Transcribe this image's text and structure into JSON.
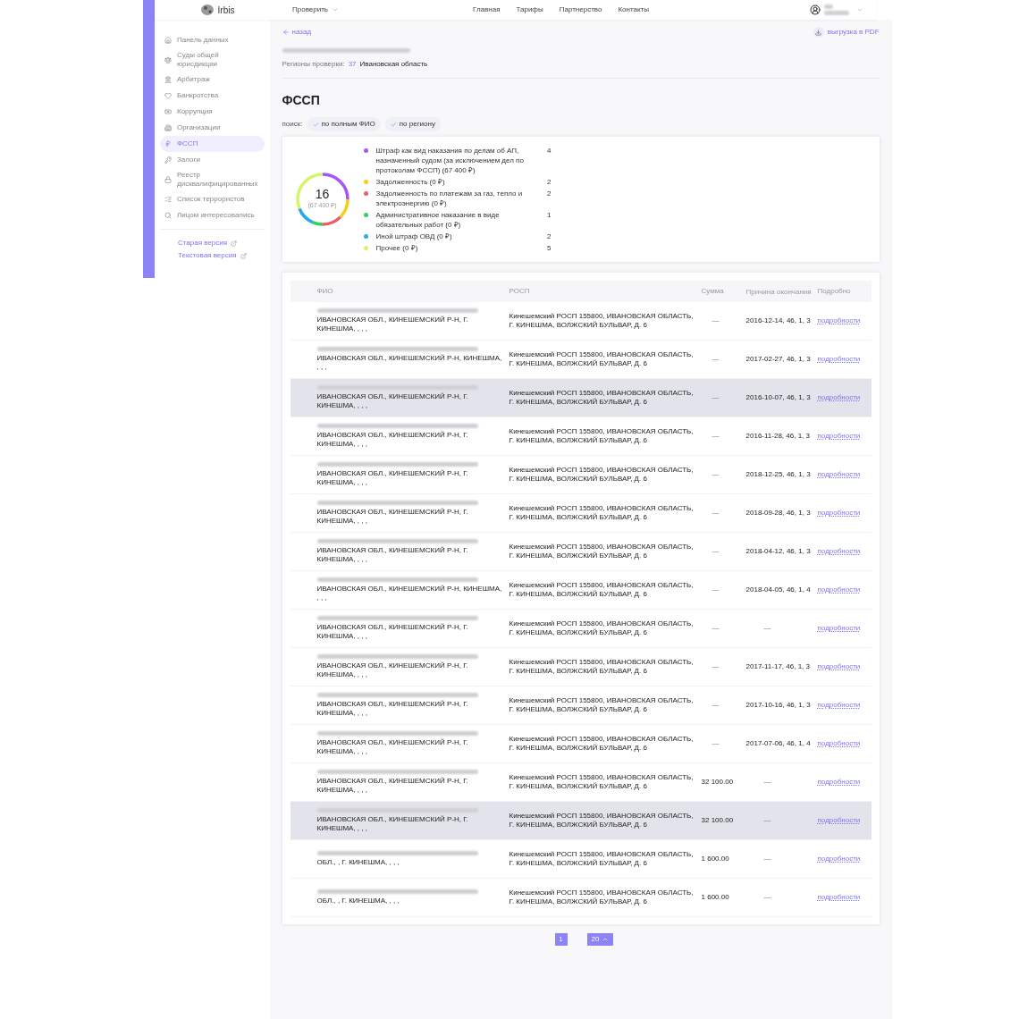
{
  "header": {
    "brand": "Irbis",
    "check_menu": "Проверить",
    "nav": [
      "Главная",
      "Тарифы",
      "Партнерство",
      "Контакты"
    ]
  },
  "sidebar": {
    "items": [
      {
        "label": "Панель данных",
        "selected": false
      },
      {
        "label": "Суды общей юрисдикции",
        "selected": false
      },
      {
        "label": "Арбитраж",
        "selected": false
      },
      {
        "label": "Банкротства",
        "selected": false
      },
      {
        "label": "Коррупция",
        "selected": false
      },
      {
        "label": "Организации",
        "selected": false
      },
      {
        "label": "ФССП",
        "selected": true
      },
      {
        "label": "Залоги",
        "selected": false
      },
      {
        "label": "Реестр дисквалифицированных",
        "selected": false
      },
      {
        "label": "Список террористов",
        "selected": false
      },
      {
        "label": "Лицом интересовались",
        "selected": false
      }
    ],
    "links": [
      "Старая версия",
      "Текстовая версия"
    ]
  },
  "back": "назад",
  "export": "выгрузка в PDF",
  "regions": {
    "label": "Регионы проверки:",
    "code": "37",
    "name": "Ивановская область"
  },
  "title": "ФССП",
  "search": {
    "label": "поиск:",
    "chips": [
      "по полным ФИО",
      "по региону"
    ]
  },
  "summary": {
    "total": "16",
    "amount": "(67 400 ₽)",
    "items": [
      {
        "label": "Штраф как вид наказания по делам об АП, назначенный судом (за исключением дел по протоколам ФССП) (67 400 ₽)",
        "count": "4",
        "color": "#a855f7"
      },
      {
        "label": "Задолженность (0 ₽)",
        "count": "2",
        "color": "#facc15"
      },
      {
        "label": "Задолженность по платежам за газ, тепло и электроэнергию (0 ₽)",
        "count": "2",
        "color": "#f05a67"
      },
      {
        "label": "Административное наказание в виде обязательных работ (0 ₽)",
        "count": "1",
        "color": "#34d058"
      },
      {
        "label": "Иной штраф ОВД (0 ₽)",
        "count": "2",
        "color": "#2aa9e8"
      },
      {
        "label": "Прочее (0 ₽)",
        "count": "5",
        "color": "#d4f56a"
      }
    ]
  },
  "table": {
    "columns": [
      "ФИО",
      "РОСП",
      "Сумма",
      "Причина окончания",
      "Подробно"
    ],
    "rows": [
      {
        "fio": "ИВАНОВСКАЯ ОБЛ., КИНЕШЕМСКИЙ Р-Н, Г. КИНЕШМА, , , ,",
        "rosp": "Кинешемский РОСП 155800, ИВАНОВСКАЯ ОБЛАСТЬ, Г. КИНЕШМА, ВОЛЖСКИЙ БУЛЬВАР, Д. 6",
        "sum": "—",
        "reason": "2016-12-14, 46, 1, 3",
        "link": "подробности",
        "shaded": false
      },
      {
        "fio": "ИВАНОВСКАЯ ОБЛ., КИНЕШЕМСКИЙ Р-Н, КИНЕШМА, , , ,",
        "rosp": "Кинешемский РОСП 155800, ИВАНОВСКАЯ ОБЛАСТЬ, Г. КИНЕШМА, ВОЛЖСКИЙ БУЛЬВАР, Д. 6",
        "sum": "—",
        "reason": "2017-02-27, 46, 1, 3",
        "link": "подробности",
        "shaded": false
      },
      {
        "fio": "ИВАНОВСКАЯ ОБЛ., КИНЕШЕМСКИЙ Р-Н, Г. КИНЕШМА, , , ,",
        "rosp": "Кинешемский РОСП 155800, ИВАНОВСКАЯ ОБЛАСТЬ, Г. КИНЕШМА, ВОЛЖСКИЙ БУЛЬВАР, Д. 6",
        "sum": "—",
        "reason": "2016-10-07, 46, 1, 3",
        "link": "подробности",
        "shaded": true
      },
      {
        "fio": "ИВАНОВСКАЯ ОБЛ., КИНЕШЕМСКИЙ Р-Н, Г. КИНЕШМА, , , ,",
        "rosp": "Кинешемский РОСП 155800, ИВАНОВСКАЯ ОБЛАСТЬ, Г. КИНЕШМА, ВОЛЖСКИЙ БУЛЬВАР, Д. 6",
        "sum": "—",
        "reason": "2016-11-28, 46, 1, 3",
        "link": "подробности",
        "shaded": false
      },
      {
        "fio": "ИВАНОВСКАЯ ОБЛ., КИНЕШЕМСКИЙ Р-Н, Г. КИНЕШМА, , , ,",
        "rosp": "Кинешемский РОСП 155800, ИВАНОВСКАЯ ОБЛАСТЬ, Г. КИНЕШМА, ВОЛЖСКИЙ БУЛЬВАР, Д. 6",
        "sum": "—",
        "reason": "2018-12-25, 46, 1, 3",
        "link": "подробности",
        "shaded": false
      },
      {
        "fio": "ИВАНОВСКАЯ ОБЛ., КИНЕШЕМСКИЙ Р-Н, Г. КИНЕШМА, , , ,",
        "rosp": "Кинешемский РОСП 155800, ИВАНОВСКАЯ ОБЛАСТЬ, Г. КИНЕШМА, ВОЛЖСКИЙ БУЛЬВАР, Д. 6",
        "sum": "—",
        "reason": "2018-09-28, 46, 1, 3",
        "link": "подробности",
        "shaded": false
      },
      {
        "fio": "ИВАНОВСКАЯ ОБЛ., КИНЕШЕМСКИЙ Р-Н, Г. КИНЕШМА, , , ,",
        "rosp": "Кинешемский РОСП 155800, ИВАНОВСКАЯ ОБЛАСТЬ, Г. КИНЕШМА, ВОЛЖСКИЙ БУЛЬВАР, Д. 6",
        "sum": "—",
        "reason": "2018-04-12, 46, 1, 3",
        "link": "подробности",
        "shaded": false
      },
      {
        "fio": "ИВАНОВСКАЯ ОБЛ., КИНЕШЕМСКИЙ Р-Н, КИНЕШМА, , , ,",
        "rosp": "Кинешемский РОСП 155800, ИВАНОВСКАЯ ОБЛАСТЬ, Г. КИНЕШМА, ВОЛЖСКИЙ БУЛЬВАР, Д. 6",
        "sum": "—",
        "reason": "2018-04-05, 46, 1, 4",
        "link": "подробности",
        "shaded": false
      },
      {
        "fio": "ИВАНОВСКАЯ ОБЛ., КИНЕШЕМСКИЙ Р-Н, Г. КИНЕШМА, , , ,",
        "rosp": "Кинешемский РОСП 155800, ИВАНОВСКАЯ ОБЛАСТЬ, Г. КИНЕШМА, ВОЛЖСКИЙ БУЛЬВАР, Д. 6",
        "sum": "—",
        "reason": "—",
        "link": "подробности",
        "shaded": false
      },
      {
        "fio": "ИВАНОВСКАЯ ОБЛ., КИНЕШЕМСКИЙ Р-Н, Г. КИНЕШМА, , , ,",
        "rosp": "Кинешемский РОСП 155800, ИВАНОВСКАЯ ОБЛАСТЬ, Г. КИНЕШМА, ВОЛЖСКИЙ БУЛЬВАР, Д. 6",
        "sum": "—",
        "reason": "2017-11-17, 46, 1, 3",
        "link": "подробности",
        "shaded": false
      },
      {
        "fio": "ИВАНОВСКАЯ ОБЛ., КИНЕШЕМСКИЙ Р-Н, Г. КИНЕШМА, , , ,",
        "rosp": "Кинешемский РОСП 155800, ИВАНОВСКАЯ ОБЛАСТЬ, Г. КИНЕШМА, ВОЛЖСКИЙ БУЛЬВАР, Д. 6",
        "sum": "—",
        "reason": "2017-10-16, 46, 1, 3",
        "link": "подробности",
        "shaded": false
      },
      {
        "fio": "ИВАНОВСКАЯ ОБЛ., КИНЕШЕМСКИЙ Р-Н, Г. КИНЕШМА, , , ,",
        "rosp": "Кинешемский РОСП 155800, ИВАНОВСКАЯ ОБЛАСТЬ, Г. КИНЕШМА, ВОЛЖСКИЙ БУЛЬВАР, Д. 6",
        "sum": "—",
        "reason": "2017-07-06, 46, 1, 4",
        "link": "подробности",
        "shaded": false
      },
      {
        "fio": "ИВАНОВСКАЯ ОБЛ., КИНЕШЕМСКИЙ Р-Н, Г. КИНЕШМА, , , ,",
        "rosp": "Кинешемский РОСП 155800, ИВАНОВСКАЯ ОБЛАСТЬ, Г. КИНЕШМА, ВОЛЖСКИЙ БУЛЬВАР, Д. 6",
        "sum": "32 100.00",
        "reason": "—",
        "link": "подробности",
        "shaded": false
      },
      {
        "fio": "ИВАНОВСКАЯ ОБЛ., КИНЕШЕМСКИЙ Р-Н, Г. КИНЕШМА, , , ,",
        "rosp": "Кинешемский РОСП 155800, ИВАНОВСКАЯ ОБЛАСТЬ, Г. КИНЕШМА, ВОЛЖСКИЙ БУЛЬВАР, Д. 6",
        "sum": "32 100.00",
        "reason": "—",
        "link": "подробности",
        "shaded": true
      },
      {
        "fio": "ОБЛ., , Г. КИНЕШМА, , , ,",
        "rosp": "Кинешемский РОСП 155800, ИВАНОВСКАЯ ОБЛАСТЬ, Г. КИНЕШМА, ВОЛЖСКИЙ БУЛЬВАР, Д. 6",
        "sum": "1 600.00",
        "reason": "—",
        "link": "подробности",
        "shaded": false
      },
      {
        "fio": "ОБЛ., , Г. КИНЕШМА, , , ,",
        "rosp": "Кинешемский РОСП 155800, ИВАНОВСКАЯ ОБЛАСТЬ, Г. КИНЕШМА, ВОЛЖСКИЙ БУЛЬВАР, Д. 6",
        "sum": "1 600.00",
        "reason": "—",
        "link": "подробности",
        "shaded": false
      }
    ]
  },
  "pagination": {
    "page": "1",
    "page_size": "20"
  }
}
